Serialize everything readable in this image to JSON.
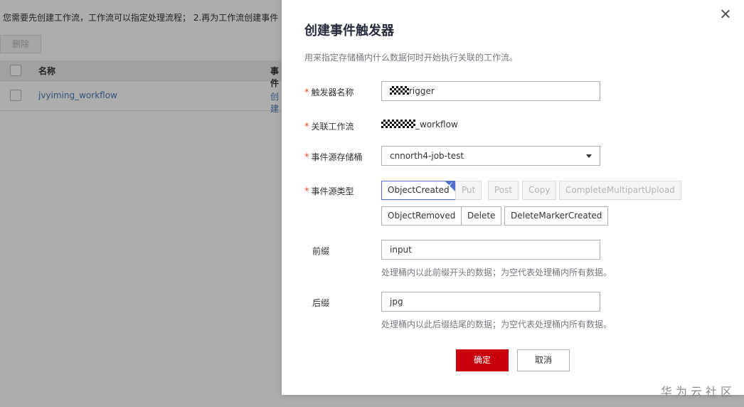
{
  "background": {
    "tip": "您需要先创建工作流，工作流可以指定处理流程；   2.再为工作流创建事件",
    "delete_button": "删除",
    "columns": [
      "名称",
      "事件"
    ],
    "rows": [
      {
        "name": "jvyiming_workflow",
        "action": "创建"
      }
    ]
  },
  "dialog": {
    "title": "创建事件触发器",
    "description": "用来指定存储桶内什么数据何时开始执行关联的工作流。",
    "required_mark": "*",
    "trigger_name": {
      "label": "触发器名称",
      "value": "rigger"
    },
    "workflow": {
      "label": "关联工作流",
      "value": "_workflow"
    },
    "bucket": {
      "label": "事件源存储桶",
      "value": "cnnorth4-job-test"
    },
    "event_type": {
      "label": "事件源类型",
      "options": [
        {
          "label": "ObjectCreated",
          "state": "selected"
        },
        {
          "label": "Put",
          "state": "disabled"
        },
        {
          "label": "Post",
          "state": "disabled"
        },
        {
          "label": "Copy",
          "state": "disabled"
        },
        {
          "label": "CompleteMultipartUpload",
          "state": "disabled"
        },
        {
          "label": "ObjectRemoved",
          "state": "normal"
        },
        {
          "label": "Delete",
          "state": "normal"
        },
        {
          "label": "DeleteMarkerCreated",
          "state": "normal"
        }
      ]
    },
    "prefix": {
      "label": "前缀",
      "value": "input",
      "hint": "处理桶内以此前缀开头的数据；为空代表处理桶内所有数据。"
    },
    "suffix": {
      "label": "后缀",
      "value": "jpg",
      "hint": "处理桶内以此后缀结尾的数据；为空代表处理桶内所有数据。"
    },
    "confirm_label": "确定",
    "cancel_label": "取消"
  },
  "watermark": "华为云社区",
  "colors": {
    "primary": "#c7000b",
    "required": "#e64a2c",
    "selected_border": "#526ecc",
    "link": "#4a78b7"
  }
}
